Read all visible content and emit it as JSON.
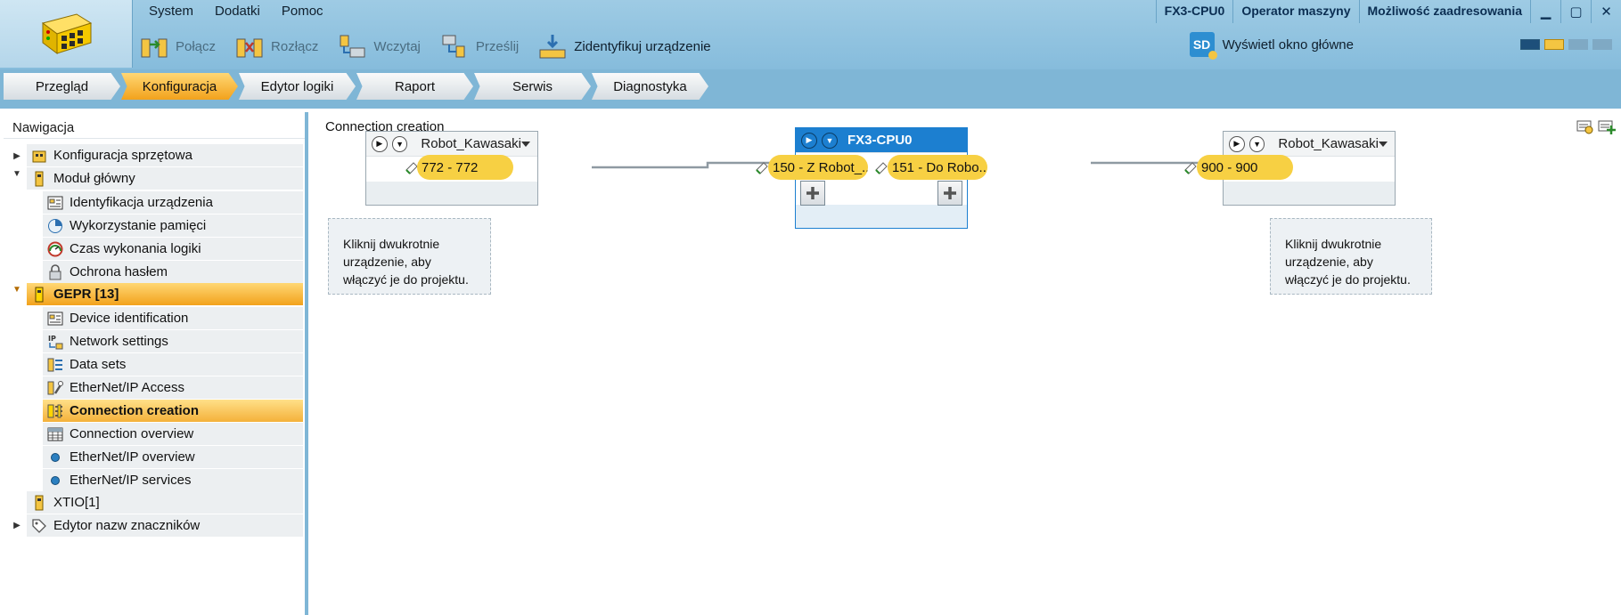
{
  "menu": [
    "System",
    "Dodatki",
    "Pomoc"
  ],
  "toolbar": {
    "connect": "Połącz",
    "disconnect": "Rozłącz",
    "load": "Wczytaj",
    "send": "Prześlij",
    "identify": "Zidentyfikuj urządzenie",
    "main_window": "Wyświetl okno główne",
    "sd_label": "SD"
  },
  "status": {
    "device": "FX3-CPU0",
    "role": "Operator maszyny",
    "addressing": "Możliwość zaadresowania"
  },
  "window_controls": {
    "minimize": "▁",
    "maximize": "▢",
    "close": "✕"
  },
  "tabs": [
    "Przegląd",
    "Konfiguracja",
    "Edytor logiki",
    "Raport",
    "Serwis",
    "Diagnostyka"
  ],
  "active_tab": "Konfiguracja",
  "nav": {
    "title": "Nawigacja",
    "items": [
      "Konfiguracja sprzętowa",
      "Moduł główny",
      "Identyfikacja urządzenia",
      "Wykorzystanie pamięci",
      "Czas wykonania logiki",
      "Ochrona hasłem",
      "GEPR [13]",
      "Device identification",
      "Network settings",
      "Data sets",
      "EtherNet/IP Access",
      "Connection creation",
      "Connection overview",
      "EtherNet/IP overview",
      "EtherNet/IP services",
      "XTIO[1]",
      "Edytor nazw znaczników"
    ],
    "selected": "Connection creation"
  },
  "work": {
    "title": "Connection creation",
    "left_device": {
      "name": "Robot_Kawasaki",
      "connection": "772 - 772"
    },
    "cpu": {
      "name": "FX3-CPU0",
      "conn_in": "150 - Z Robot_...",
      "conn_out": "151 - Do Robo..."
    },
    "right_device": {
      "name": "Robot_Kawasaki",
      "connection": "900 - 900"
    },
    "hint": "Kliknij dwukrotnie urządzenie, aby włączyć je do projektu."
  },
  "colors": {
    "accent": "#f2a21c",
    "cpu_header": "#1c7fd0",
    "pill": "#f7d043",
    "frame": "#7fb6d6"
  }
}
